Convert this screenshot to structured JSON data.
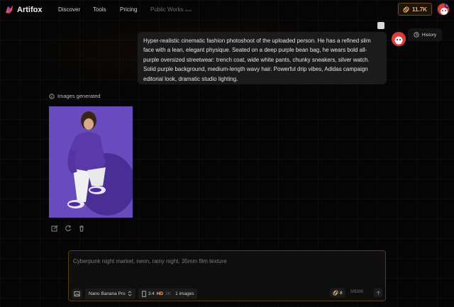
{
  "header": {
    "brand": "Artifox",
    "nav": [
      "Discover",
      "Tools",
      "Pricing",
      "Public Works"
    ],
    "soon_label": "Soon",
    "credits": "11.7K",
    "accent_color": "#f0b86a"
  },
  "chat": {
    "prompt_text": "Hyper-realistic cinematic fashion photoshoot of the uploaded person. He has a refined slim face with a lean, elegant physique. Seated on a deep purple bean bag, he wears bold all-purple oversized streetwear: trench coat, wide white pants, chunky sneakers, silver watch. Solid purple background, medium-length wavy hair. Powerful drip vibes, Adidas campaign editorial look, dramatic studio lighting.",
    "history_label": "History",
    "images_generated_label": "Images generated"
  },
  "composer": {
    "placeholder": "Cyberpunk night market, neon, rainy night, 35mm film texture",
    "model": "Nano Banana Pro",
    "ratio": "3:4",
    "quality_hd": "HD",
    "quality_2k": "2K",
    "image_count": "1 images",
    "cost": "8",
    "char_count": "0/5000"
  }
}
